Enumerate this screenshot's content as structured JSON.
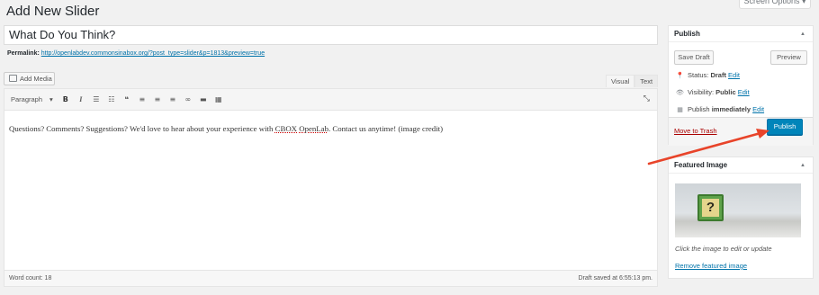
{
  "page": {
    "title": "Add New Slider",
    "screen_options": "Screen Options ▾"
  },
  "post": {
    "title": "What Do You Think?",
    "permalink_label": "Permalink:",
    "permalink_url": "http://openlabdev.commonsinabox.org/?post_type=slider&p=1813&preview=true"
  },
  "editor": {
    "add_media": "Add Media",
    "tabs": [
      "Visual",
      "Text"
    ],
    "format_select": "Paragraph",
    "toolbar_icons": [
      "bold-icon",
      "italic-icon",
      "bullet-list-icon",
      "numbered-list-icon",
      "blockquote-icon",
      "align-left-icon",
      "align-center-icon",
      "align-right-icon",
      "link-icon",
      "read-more-icon",
      "toolbar-toggle-icon"
    ],
    "content_before": "Questions? Comments? Suggestions? We'd love to hear about your experience with ",
    "content_sq1": "CBOX",
    "content_sq2": "OpenLab",
    "content_after": ". Contact us anytime! (image credit)",
    "word_count": "Word count: 18",
    "draft_saved": "Draft saved at 6:55:13 pm."
  },
  "publish_box": {
    "title": "Publish",
    "save_draft": "Save Draft",
    "preview": "Preview",
    "status_label": "Status: ",
    "status_value": "Draft",
    "visibility_label": "Visibility: ",
    "visibility_value": "Public",
    "schedule_label": "Publish ",
    "schedule_value": "immediately",
    "edit": "Edit",
    "move_to_trash": "Move to Trash",
    "publish": "Publish"
  },
  "featured_image": {
    "title": "Featured Image",
    "caption": "Click the image to edit or update",
    "remove": "Remove featured image"
  },
  "colors": {
    "accent": "#0085ba",
    "link": "#0073aa",
    "trash": "#a00",
    "arrow": "#e8442a"
  }
}
